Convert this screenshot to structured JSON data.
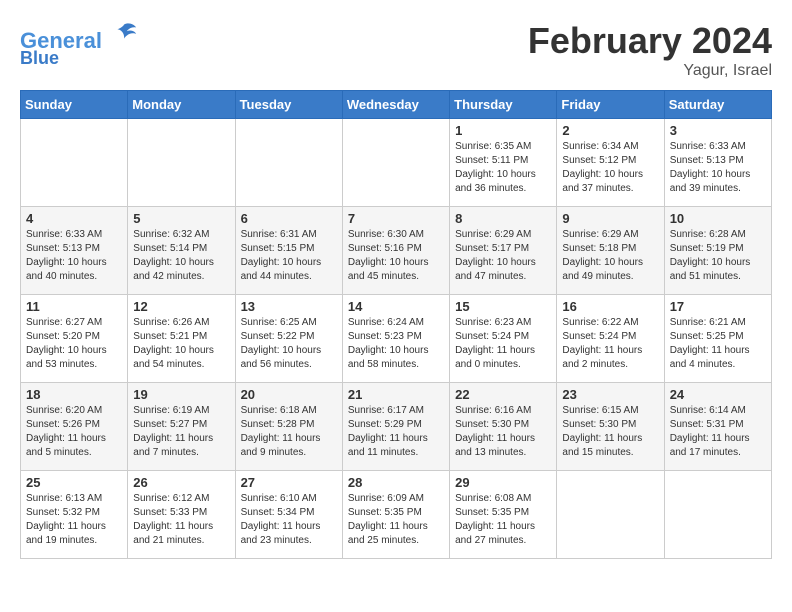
{
  "header": {
    "logo_line1": "General",
    "logo_line2": "Blue",
    "month_title": "February 2024",
    "location": "Yagur, Israel"
  },
  "weekdays": [
    "Sunday",
    "Monday",
    "Tuesday",
    "Wednesday",
    "Thursday",
    "Friday",
    "Saturday"
  ],
  "weeks": [
    [
      {
        "day": "",
        "info": ""
      },
      {
        "day": "",
        "info": ""
      },
      {
        "day": "",
        "info": ""
      },
      {
        "day": "",
        "info": ""
      },
      {
        "day": "1",
        "info": "Sunrise: 6:35 AM\nSunset: 5:11 PM\nDaylight: 10 hours\nand 36 minutes."
      },
      {
        "day": "2",
        "info": "Sunrise: 6:34 AM\nSunset: 5:12 PM\nDaylight: 10 hours\nand 37 minutes."
      },
      {
        "day": "3",
        "info": "Sunrise: 6:33 AM\nSunset: 5:13 PM\nDaylight: 10 hours\nand 39 minutes."
      }
    ],
    [
      {
        "day": "4",
        "info": "Sunrise: 6:33 AM\nSunset: 5:13 PM\nDaylight: 10 hours\nand 40 minutes."
      },
      {
        "day": "5",
        "info": "Sunrise: 6:32 AM\nSunset: 5:14 PM\nDaylight: 10 hours\nand 42 minutes."
      },
      {
        "day": "6",
        "info": "Sunrise: 6:31 AM\nSunset: 5:15 PM\nDaylight: 10 hours\nand 44 minutes."
      },
      {
        "day": "7",
        "info": "Sunrise: 6:30 AM\nSunset: 5:16 PM\nDaylight: 10 hours\nand 45 minutes."
      },
      {
        "day": "8",
        "info": "Sunrise: 6:29 AM\nSunset: 5:17 PM\nDaylight: 10 hours\nand 47 minutes."
      },
      {
        "day": "9",
        "info": "Sunrise: 6:29 AM\nSunset: 5:18 PM\nDaylight: 10 hours\nand 49 minutes."
      },
      {
        "day": "10",
        "info": "Sunrise: 6:28 AM\nSunset: 5:19 PM\nDaylight: 10 hours\nand 51 minutes."
      }
    ],
    [
      {
        "day": "11",
        "info": "Sunrise: 6:27 AM\nSunset: 5:20 PM\nDaylight: 10 hours\nand 53 minutes."
      },
      {
        "day": "12",
        "info": "Sunrise: 6:26 AM\nSunset: 5:21 PM\nDaylight: 10 hours\nand 54 minutes."
      },
      {
        "day": "13",
        "info": "Sunrise: 6:25 AM\nSunset: 5:22 PM\nDaylight: 10 hours\nand 56 minutes."
      },
      {
        "day": "14",
        "info": "Sunrise: 6:24 AM\nSunset: 5:23 PM\nDaylight: 10 hours\nand 58 minutes."
      },
      {
        "day": "15",
        "info": "Sunrise: 6:23 AM\nSunset: 5:24 PM\nDaylight: 11 hours\nand 0 minutes."
      },
      {
        "day": "16",
        "info": "Sunrise: 6:22 AM\nSunset: 5:24 PM\nDaylight: 11 hours\nand 2 minutes."
      },
      {
        "day": "17",
        "info": "Sunrise: 6:21 AM\nSunset: 5:25 PM\nDaylight: 11 hours\nand 4 minutes."
      }
    ],
    [
      {
        "day": "18",
        "info": "Sunrise: 6:20 AM\nSunset: 5:26 PM\nDaylight: 11 hours\nand 5 minutes."
      },
      {
        "day": "19",
        "info": "Sunrise: 6:19 AM\nSunset: 5:27 PM\nDaylight: 11 hours\nand 7 minutes."
      },
      {
        "day": "20",
        "info": "Sunrise: 6:18 AM\nSunset: 5:28 PM\nDaylight: 11 hours\nand 9 minutes."
      },
      {
        "day": "21",
        "info": "Sunrise: 6:17 AM\nSunset: 5:29 PM\nDaylight: 11 hours\nand 11 minutes."
      },
      {
        "day": "22",
        "info": "Sunrise: 6:16 AM\nSunset: 5:30 PM\nDaylight: 11 hours\nand 13 minutes."
      },
      {
        "day": "23",
        "info": "Sunrise: 6:15 AM\nSunset: 5:30 PM\nDaylight: 11 hours\nand 15 minutes."
      },
      {
        "day": "24",
        "info": "Sunrise: 6:14 AM\nSunset: 5:31 PM\nDaylight: 11 hours\nand 17 minutes."
      }
    ],
    [
      {
        "day": "25",
        "info": "Sunrise: 6:13 AM\nSunset: 5:32 PM\nDaylight: 11 hours\nand 19 minutes."
      },
      {
        "day": "26",
        "info": "Sunrise: 6:12 AM\nSunset: 5:33 PM\nDaylight: 11 hours\nand 21 minutes."
      },
      {
        "day": "27",
        "info": "Sunrise: 6:10 AM\nSunset: 5:34 PM\nDaylight: 11 hours\nand 23 minutes."
      },
      {
        "day": "28",
        "info": "Sunrise: 6:09 AM\nSunset: 5:35 PM\nDaylight: 11 hours\nand 25 minutes."
      },
      {
        "day": "29",
        "info": "Sunrise: 6:08 AM\nSunset: 5:35 PM\nDaylight: 11 hours\nand 27 minutes."
      },
      {
        "day": "",
        "info": ""
      },
      {
        "day": "",
        "info": ""
      }
    ]
  ]
}
